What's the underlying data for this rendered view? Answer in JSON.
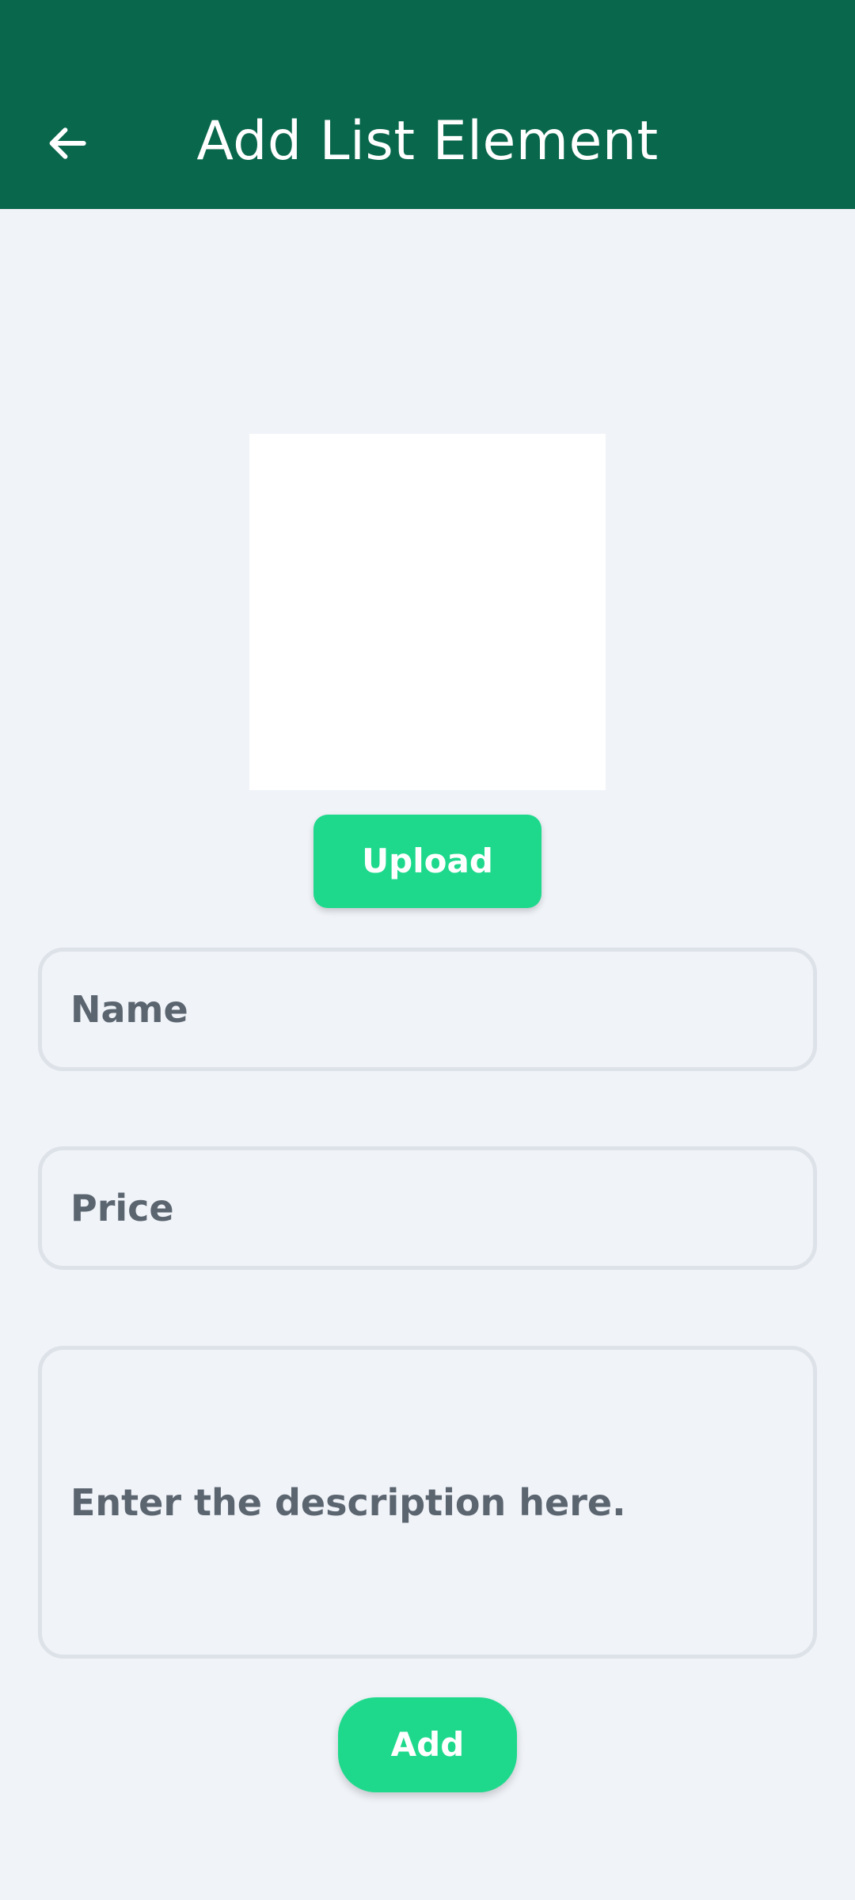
{
  "header": {
    "title": "Add List Element",
    "back_icon": "arrow-left-icon",
    "background_color": "#09674b"
  },
  "image_picker": {
    "upload_label": "Upload"
  },
  "form": {
    "name_placeholder": "Name",
    "price_placeholder": "Price",
    "description_placeholder": "Enter the description here."
  },
  "actions": {
    "add_label": "Add",
    "accent_color": "#1ed98c"
  }
}
